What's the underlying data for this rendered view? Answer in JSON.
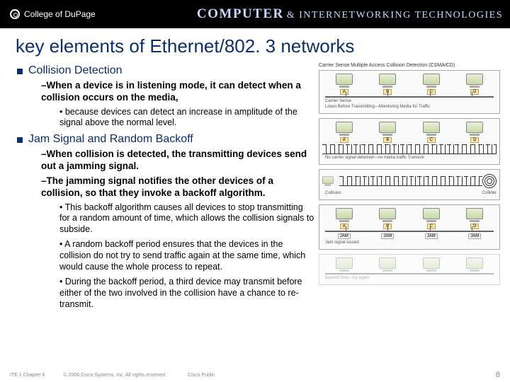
{
  "header": {
    "college": "College of DuPage",
    "right_bold": "COMPUTER",
    "right_rest": "& INTERNETWORKING TECHNOLOGIES"
  },
  "title": "key elements of Ethernet/802. 3 networks",
  "sec1": {
    "h": "Collision Detection",
    "p1": "–When a device is in listening mode, it can detect when a collision occurs on the media,",
    "b1": "• because devices can detect an increase in amplitude of the signal above the normal level."
  },
  "sec2": {
    "h": "Jam Signal and Random Backoff",
    "p1": "–When collision is detected, the transmitting devices send out a jamming signal.",
    "p2": "–The jamming signal notifies the other devices of a collision, so that they invoke a backoff algorithm.",
    "b1": "• This backoff algorithm causes all devices to stop transmitting for a random amount of time, which allows the collision signals to subside.",
    "b2": "• A random backoff period ensures that the devices in the collision do not try to send traffic again at the same time, which would cause the whole process to repeat.",
    "b3": "• During the backoff period, a third device may transmit before either of the two involved in the collision have a chance to re-transmit."
  },
  "diagram": {
    "title": "Carrier Sense Multiple Access Collision Detection (CSMA/CD)",
    "labels": {
      "a": "A",
      "b": "B",
      "c": "C",
      "d": "D"
    },
    "cap1a": "Carrier Sense",
    "cap1b": "Listen Before Transmitting—Monitoring Media for Traffic",
    "cap2": "No carrier signal detected—no media traffic Transmit",
    "cap3a": "Collision",
    "cap3b": "Collider",
    "jam": "JAM",
    "cap4": "Jam signal issued",
    "cap5": "Backoff time—try again"
  },
  "footer": {
    "f1": "ITE 1 Chapter 6",
    "f2": "© 2006 Cisco Systems, Inc. All rights reserved.",
    "f3": "Cisco Public",
    "page": "8"
  }
}
